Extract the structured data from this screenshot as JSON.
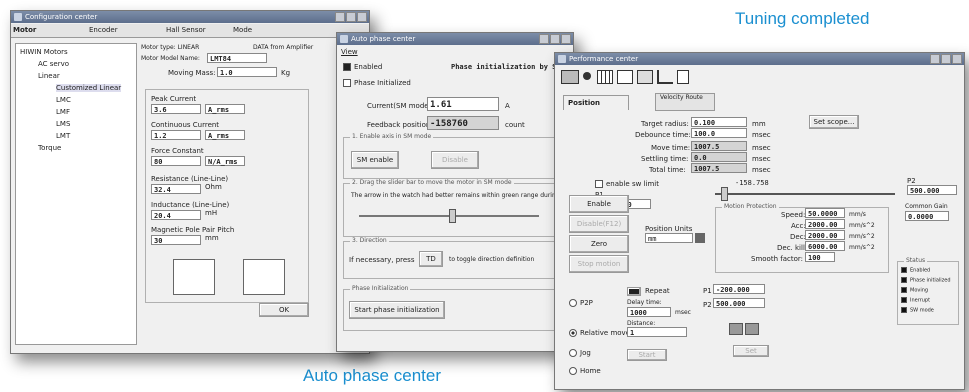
{
  "captions": {
    "tuning": "Tuning completed",
    "auto_phase": "Auto phase center"
  },
  "config": {
    "title": "Configuration center",
    "tabs": [
      "Motor",
      "Encoder",
      "Hall Sensor",
      "Mode"
    ],
    "tree": {
      "root": "HIWIN Motors",
      "ac": "AC servo",
      "linear": "Linear",
      "custom": "Customized Linear",
      "lmc": "LMC",
      "lmf": "LMF",
      "lms": "LMS",
      "lmt": "LMT",
      "torque": "Torque"
    },
    "motor_type_label": "Motor type: LINEAR",
    "data_from": "DATA from Amplifier",
    "model_label": "Motor Model Name:",
    "model_value": "LMT84",
    "moving_mass_label": "Moving Mass:",
    "moving_mass_value": "1.0",
    "moving_mass_unit": "Kg",
    "peak_current_label": "Peak Current",
    "peak_current_value": "3.6",
    "peak_current_unit": "A_rms",
    "cont_current_label": "Continuous Current",
    "cont_current_value": "1.2",
    "cont_current_unit": "A_rms",
    "force_const_label": "Force Constant",
    "force_const_value": "80",
    "force_const_unit": "N/A_rms",
    "resistance_label": "Resistance (Line-Line)",
    "resistance_value": "32.4",
    "resistance_unit": "Ohm",
    "inductance_label": "Inductance (Line-Line)",
    "inductance_value": "20.4",
    "inductance_unit": "mH",
    "pole_pair_label": "Magnetic Pole Pair Pitch",
    "pole_pair_value": "30",
    "pole_pair_unit": "mm",
    "ok": "OK"
  },
  "auto": {
    "title": "Auto phase center",
    "menu": "View",
    "enabled": "Enabled",
    "phase_init": "Phase Initialized",
    "banner": "Phase initialization by SW",
    "current_label": "Current(SM mode):",
    "current_value": "1.61",
    "current_unit": "A",
    "feedback_label": "Feedback position:",
    "feedback_value": "-158760",
    "feedback_unit": "count",
    "step1": "1. Enable axis in SM mode",
    "sm_enable": "SM enable",
    "disable": "Disable",
    "step2a": "2. Drag the slider bar to move the motor in SM mode",
    "step2b": "The arrow in the watch had better remains within green range during",
    "step3": "3. Direction",
    "step3_text": "If necessary, press",
    "td": "TD",
    "step3_tail": "to toggle direction definition",
    "phase_group": "Phase Initialization",
    "start_btn": "Start phase initialization"
  },
  "perf": {
    "title": "Performance center",
    "tabs": [
      "Position",
      "Velocity Route"
    ],
    "target_label": "Target radius:",
    "target_value": "0.100",
    "target_unit": "mm",
    "debounce_label": "Debounce time:",
    "debounce_value": "100.0",
    "debounce_unit": "msec",
    "move_label": "Move time:",
    "move_value": "1007.5",
    "move_unit": "msec",
    "settle_label": "Settling time:",
    "settle_value": "0.0",
    "settle_unit": "msec",
    "total_label": "Total time:",
    "total_value": "1007.5",
    "total_unit": "msec",
    "scope_btn": "Set scope...",
    "sw_limit": "enable sw limit",
    "p1_label": "P1",
    "p1_value": "-200.000",
    "slider_value": "-158.758",
    "p2_label": "P2",
    "p2_value": "500.000",
    "enable_btn": "Enable",
    "disable_btn": "Disable(F12)",
    "units_label": "Position Units",
    "units_value": "mm",
    "zero_btn": "Zero",
    "stop_btn": "Stop motion",
    "motion_group": "Motion Protection",
    "speed_label": "Speed:",
    "speed_value": "50.0000",
    "speed_unit": "mm/s",
    "acc_label": "Acc:",
    "acc_value": "2000.00",
    "acc_unit": "mm/s^2",
    "dec_label": "Dec:",
    "dec_value": "2000.00",
    "dec_unit": "mm/s^2",
    "deckill_label": "Dec. kill:",
    "deckill_value": "6000.00",
    "deckill_unit": "mm/s^2",
    "smooth_label": "Smooth factor:",
    "smooth_value": "100",
    "common_gain_label": "Common Gain",
    "common_gain_value": "0.0000",
    "p2p": "P2P",
    "repeat": "Repeat",
    "delay_label": "Delay time:",
    "delay_value": "1000",
    "delay_unit": "msec",
    "p1b_label": "P1",
    "p1b_value": "-200.000",
    "p2b_label": "P2",
    "p2b_value": "500.000",
    "relative": "Relative move",
    "distance_label": "Distance:",
    "distance_value": "1",
    "jog": "Jog",
    "home": "Home",
    "home_start": "Start",
    "home_set": "Set",
    "status_title": "Status",
    "status_items": [
      "Enabled",
      "Phase initialized",
      "Moving",
      "Inerrupt",
      "SW mode"
    ],
    "status_colors": [
      "#101010",
      "#101010",
      "#101010",
      "#101010",
      "#101010"
    ]
  }
}
